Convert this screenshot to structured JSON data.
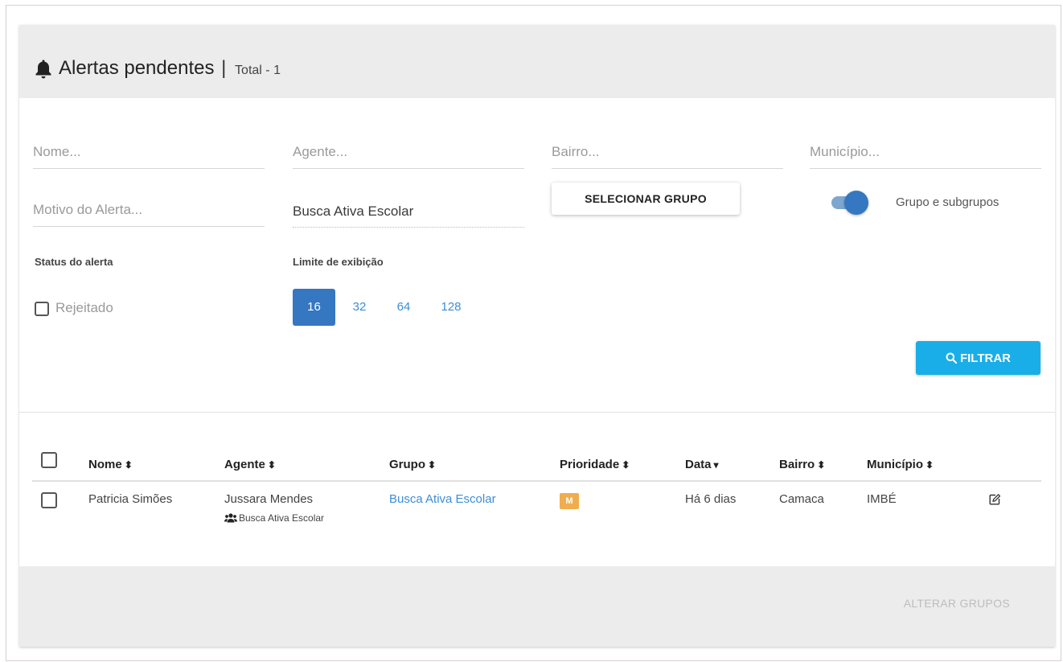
{
  "header": {
    "icon": "bell-icon",
    "title": "Alertas pendentes",
    "separator": "|",
    "total_text": "Total - 1"
  },
  "filters": {
    "nome_placeholder": "Nome...",
    "agente_placeholder": "Agente...",
    "bairro_placeholder": "Bairro...",
    "municipio_placeholder": "Município...",
    "motivo_placeholder": "Motivo do Alerta...",
    "grupo_value": "Busca Ativa Escolar",
    "select_group_label": "SELECIONAR GRUPO",
    "toggle_label": "Grupo e subgrupos",
    "toggle_on": true,
    "status_label": "Status do alerta",
    "status_option": "Rejeitado",
    "status_checked": false,
    "limit_label": "Limite de exibição",
    "limits": [
      "16",
      "32",
      "64",
      "128"
    ],
    "limit_selected": "16",
    "filter_button": "FILTRAR"
  },
  "table": {
    "columns": [
      "Nome",
      "Agente",
      "Grupo",
      "Prioridade",
      "Data",
      "Bairro",
      "Município"
    ],
    "sort_icons": [
      "⬍",
      "⬍",
      "⬍",
      "⬍",
      "▾",
      "⬍",
      "⬍"
    ],
    "rows": [
      {
        "nome": "Patricia Simões",
        "agente": "Jussara Mendes",
        "agente_grupo": "Busca Ativa Escolar",
        "grupo": "Busca Ativa Escolar",
        "prioridade": "M",
        "data": "Há 6 dias",
        "bairro": "Camaca",
        "municipio": "IMBÉ"
      }
    ]
  },
  "footer": {
    "button": "ALTERAR GRUPOS"
  },
  "colors": {
    "primary": "#3577c0",
    "filter_button": "#19aee8",
    "badge": "#f0ad4e",
    "link": "#3c8dd9"
  }
}
